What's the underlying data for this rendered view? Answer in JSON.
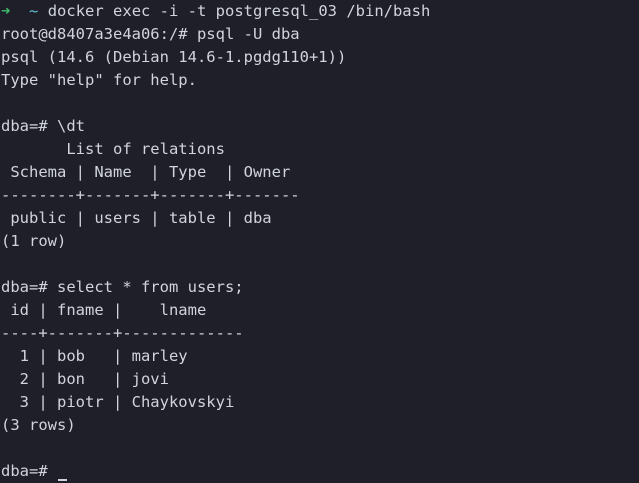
{
  "terminal": {
    "prompt_arrow": "➜",
    "prompt_dir": "~",
    "lines": [
      "docker exec -i -t postgresql_03 /bin/bash",
      "root@d8407a3e4a06:/# psql -U dba",
      "psql (14.6 (Debian 14.6-1.pgdg110+1))",
      "Type \"help\" for help.",
      "",
      "dba=# \\dt",
      "       List of relations",
      " Schema | Name  | Type  | Owner",
      "--------+-------+-------+-------",
      " public | users | table | dba",
      "(1 row)",
      "",
      "dba=# select * from users;",
      " id | fname |    lname",
      "----+-------+-------------",
      "  1 | bob   | marley",
      "  2 | bon   | jovi",
      "  3 | piotr | Chaykovskyi",
      "(3 rows)",
      "",
      "dba=# "
    ]
  }
}
